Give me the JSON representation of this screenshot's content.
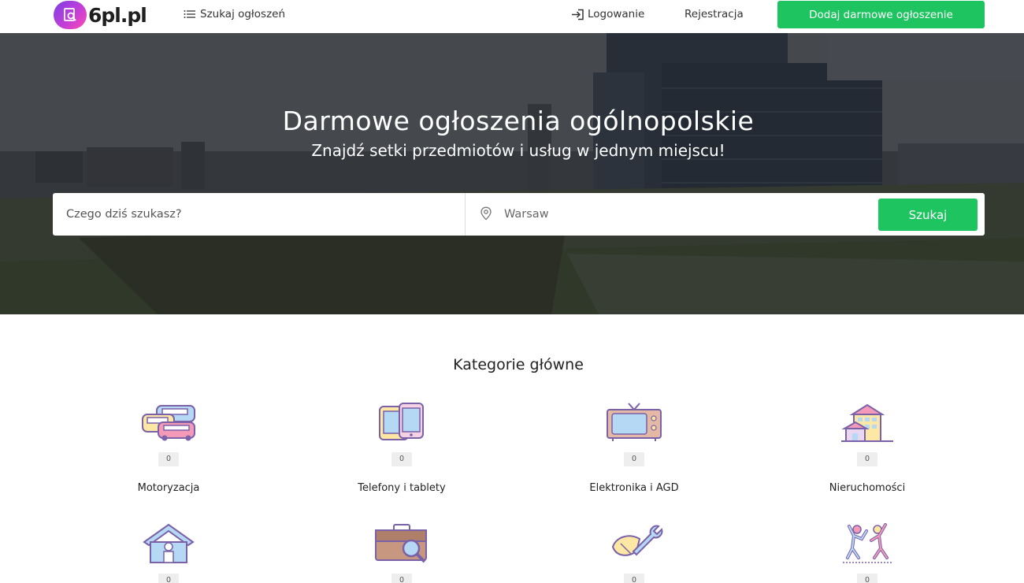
{
  "header": {
    "logo_text": "6pl.pl",
    "search_link": "Szukaj ogłoszeń",
    "login": "Logowanie",
    "register": "Rejestracja",
    "add_button": "Dodaj darmowe ogłoszenie"
  },
  "hero": {
    "title": "Darmowe ogłoszenia ogólnopolskie",
    "subtitle": "Znajdź setki przedmiotów i usług w jednym miejscu!",
    "search_placeholder": "Czego dziś szukasz?",
    "location_placeholder": "Warsaw",
    "search_button": "Szukaj"
  },
  "categories": {
    "title": "Kategorie główne",
    "items": [
      {
        "label": "Motoryzacja",
        "count": "0",
        "icon": "cars-icon"
      },
      {
        "label": "Telefony i tablety",
        "count": "0",
        "icon": "phones-icon"
      },
      {
        "label": "Elektronika i AGD",
        "count": "0",
        "icon": "tv-icon"
      },
      {
        "label": "Nieruchomości",
        "count": "0",
        "icon": "buildings-icon"
      },
      {
        "label": "",
        "count": "0",
        "icon": "house-icon"
      },
      {
        "label": "",
        "count": "0",
        "icon": "briefcase-search-icon"
      },
      {
        "label": "",
        "count": "0",
        "icon": "tools-icon"
      },
      {
        "label": "",
        "count": "0",
        "icon": "people-dancing-icon"
      }
    ]
  },
  "colors": {
    "accent": "#1ec460",
    "icon_purple": "#9d7fc1",
    "icon_pink": "#f49ab8",
    "icon_blue": "#b5d9f5",
    "icon_yellow": "#fde7a5"
  }
}
